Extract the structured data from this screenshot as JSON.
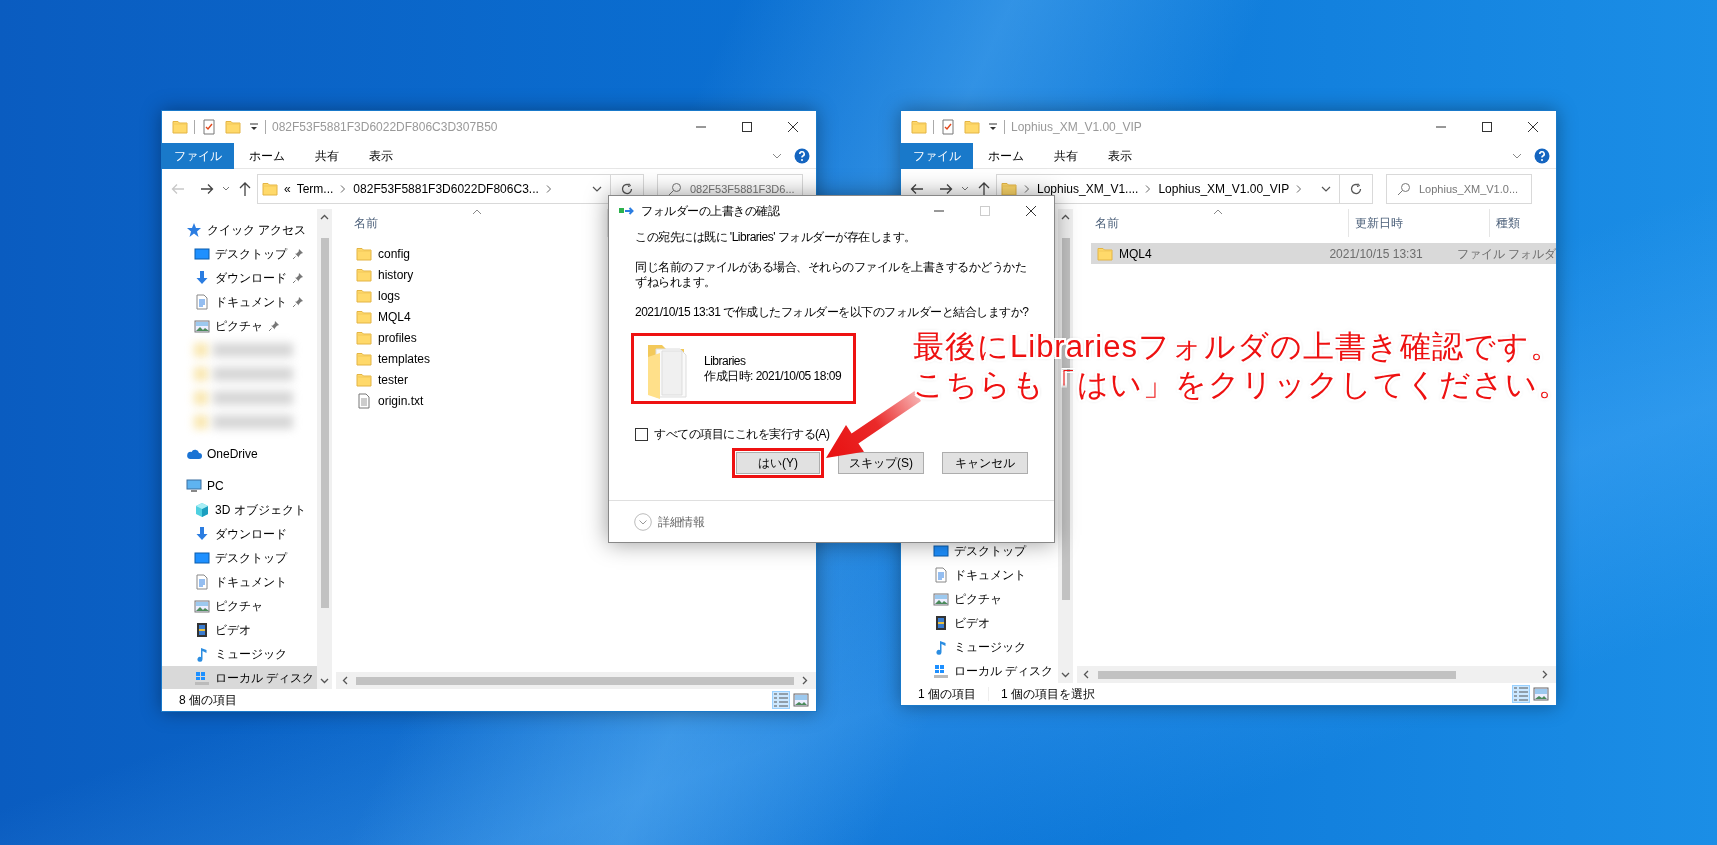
{
  "left_window": {
    "title": "082F53F5881F3D6022DF806C3D307B50",
    "ribbon_tabs": [
      {
        "label": "ファイル",
        "selected": true
      },
      {
        "label": "ホーム",
        "selected": false
      },
      {
        "label": "共有",
        "selected": false
      },
      {
        "label": "表示",
        "selected": false
      }
    ],
    "back_disabled": true,
    "address": {
      "prefix": "«",
      "leading_separator": false,
      "segments": [
        "Term...",
        "082F53F5881F3D6022DF806C3..."
      ]
    },
    "search": {
      "placeholder": "082F53F5881F3D6..."
    },
    "nav": [
      {
        "label": "クイック アクセス",
        "kind": "star",
        "selected": false,
        "children": [
          {
            "label": "デスクトップ",
            "kind": "desktop",
            "pinned": true,
            "selected": false
          },
          {
            "label": "ダウンロード",
            "kind": "download",
            "pinned": true,
            "selected": false
          },
          {
            "label": "ドキュメント",
            "kind": "document",
            "pinned": true,
            "selected": false
          },
          {
            "label": "ピクチャ",
            "kind": "pictures",
            "pinned": true,
            "selected": false
          },
          {
            "kind": "blurred",
            "selected": false
          },
          {
            "kind": "blurred",
            "selected": false
          },
          {
            "kind": "blurred",
            "selected": false
          },
          {
            "kind": "blurred",
            "selected": false
          }
        ]
      },
      {
        "label": "OneDrive",
        "kind": "cloud",
        "selected": false
      },
      {
        "label": "PC",
        "kind": "pc",
        "selected": false,
        "children": [
          {
            "label": "3D オブジェクト",
            "kind": "cube",
            "selected": false
          },
          {
            "label": "ダウンロード",
            "kind": "download",
            "selected": false
          },
          {
            "label": "デスクトップ",
            "kind": "desktop",
            "selected": false
          },
          {
            "label": "ドキュメント",
            "kind": "document",
            "selected": false
          },
          {
            "label": "ピクチャ",
            "kind": "pictures",
            "selected": false
          },
          {
            "label": "ビデオ",
            "kind": "videos",
            "selected": false
          },
          {
            "label": "ミュージック",
            "kind": "music",
            "selected": false
          },
          {
            "label": "ローカル ディスク",
            "kind": "drive",
            "selected": true
          }
        ]
      }
    ],
    "columns": [
      {
        "label": "名前",
        "sorted": true
      }
    ],
    "files": [
      {
        "name": "config",
        "kind": "folder",
        "selected": false
      },
      {
        "name": "history",
        "kind": "folder",
        "selected": false
      },
      {
        "name": "logs",
        "kind": "folder",
        "selected": false
      },
      {
        "name": "MQL4",
        "kind": "folder",
        "selected": false
      },
      {
        "name": "profiles",
        "kind": "folder",
        "selected": false
      },
      {
        "name": "templates",
        "kind": "folder",
        "selected": false
      },
      {
        "name": "tester",
        "kind": "folder",
        "selected": false
      },
      {
        "name": "origin.txt",
        "kind": "file",
        "selected": false
      }
    ],
    "status": [
      "8 個の項目"
    ],
    "views": [
      {
        "kind": "details",
        "selected": true
      },
      {
        "kind": "tiles",
        "selected": false
      }
    ]
  },
  "right_window": {
    "title": "Lophius_XM_V1.00_VIP",
    "ribbon_tabs": [
      {
        "label": "ファイル",
        "selected": true
      },
      {
        "label": "ホーム",
        "selected": false
      },
      {
        "label": "共有",
        "selected": false
      },
      {
        "label": "表示",
        "selected": false
      }
    ],
    "back_disabled": false,
    "address": {
      "leading_separator": true,
      "segments": [
        "Lophius_XM_V1....",
        "Lophius_XM_V1.00_VIP"
      ]
    },
    "search": {
      "placeholder": "Lophius_XM_V1.0..."
    },
    "nav": [
      {
        "label": "デスクトップ",
        "kind": "desktop",
        "selected": false
      },
      {
        "label": "ドキュメント",
        "kind": "document",
        "selected": false
      },
      {
        "label": "ピクチャ",
        "kind": "pictures",
        "selected": false
      },
      {
        "label": "ビデオ",
        "kind": "videos",
        "selected": false
      },
      {
        "label": "ミュージック",
        "kind": "music",
        "selected": false
      },
      {
        "label": "ローカル ディスク",
        "kind": "drive",
        "selected": false
      }
    ],
    "columns": [
      {
        "label": "名前",
        "sorted": true
      },
      {
        "label": "更新日時",
        "sorted": false
      },
      {
        "label": "種類",
        "sorted": false
      }
    ],
    "files": [
      {
        "name": "MQL4",
        "kind": "folder",
        "selected": true,
        "date": "2021/10/15 13:31",
        "type": "ファイル フォルダ"
      }
    ],
    "status": [
      "1 個の項目",
      "1 個の項目を選択"
    ],
    "views": [
      {
        "kind": "details",
        "selected": true
      },
      {
        "kind": "tiles",
        "selected": false
      }
    ]
  },
  "dialog": {
    "title": "フォルダーの上書きの確認",
    "messages": [
      "この宛先には既に 'Libraries' フォルダーが存在します。",
      "同じ名前のファイルがある場合、それらのファイルを上書きするかどうかたずねられます。",
      "2021/10/15 13:31 で作成したフォルダーを以下のフォルダーと結合しますか?"
    ],
    "folder": {
      "name": "Libraries",
      "created": "作成日時: 2021/10/05 18:09",
      "highlighted": true
    },
    "apply_all": {
      "label": "すべての項目にこれを実行する(A)",
      "checked": false
    },
    "buttons": [
      {
        "label": "はい(Y)",
        "highlighted": true
      },
      {
        "label": "スキップ(S)",
        "highlighted": false
      },
      {
        "label": "キャンセル",
        "highlighted": false
      }
    ],
    "details": "詳細情報"
  },
  "annotation": {
    "lines": [
      "最後にLibrariesフォルダの上書き確認です。",
      "こちらも「はい」をクリックしてください。"
    ]
  }
}
